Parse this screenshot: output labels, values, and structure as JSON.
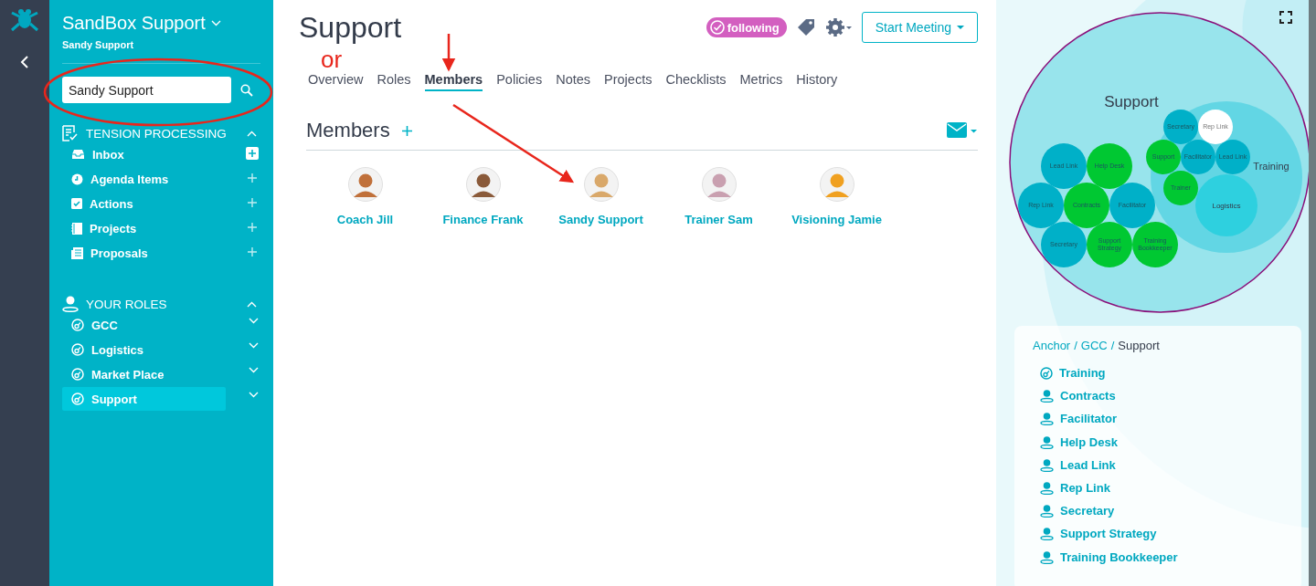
{
  "org": {
    "name": "SandBox Support",
    "user": "Sandy Support"
  },
  "search": {
    "value": "Sandy Support"
  },
  "sections": [
    {
      "title": "TENSION PROCESSING",
      "kind": "tension",
      "expanded": true,
      "items": [
        {
          "label": "Inbox",
          "kind": "inbox",
          "selected": false,
          "highlight": true
        },
        {
          "label": "Agenda Items",
          "kind": "agenda",
          "selected": false,
          "highlight": false
        },
        {
          "label": "Actions",
          "kind": "actions",
          "selected": false,
          "highlight": false
        },
        {
          "label": "Projects",
          "kind": "projects",
          "selected": false,
          "highlight": false
        },
        {
          "label": "Proposals",
          "kind": "proposals",
          "selected": false,
          "highlight": false
        }
      ]
    },
    {
      "title": "YOUR ROLES",
      "kind": "roles",
      "expanded": true,
      "items": [
        {
          "label": "GCC",
          "kind": "circle",
          "selected": false
        },
        {
          "label": "Logistics",
          "kind": "circle",
          "selected": false
        },
        {
          "label": "Market Place",
          "kind": "circle",
          "selected": false
        },
        {
          "label": "Support",
          "kind": "circle",
          "selected": true
        }
      ]
    }
  ],
  "page": {
    "title": "Support",
    "following": "following",
    "start_meeting": "Start Meeting"
  },
  "tabs": [
    {
      "label": "Overview",
      "selected": false
    },
    {
      "label": "Roles",
      "selected": false
    },
    {
      "label": "Members",
      "selected": true
    },
    {
      "label": "Policies",
      "selected": false
    },
    {
      "label": "Notes",
      "selected": false
    },
    {
      "label": "Projects",
      "selected": false
    },
    {
      "label": "Checklists",
      "selected": false
    },
    {
      "label": "Metrics",
      "selected": false
    },
    {
      "label": "History",
      "selected": false
    }
  ],
  "members_heading": "Members",
  "members": [
    {
      "name": "Coach Jill",
      "color": "#c0703a"
    },
    {
      "name": "Finance Frank",
      "color": "#8a5a3a"
    },
    {
      "name": "Sandy Support",
      "color": "#d9a86a"
    },
    {
      "name": "Trainer Sam",
      "color": "#c9a0b0"
    },
    {
      "name": "Visioning Jamie",
      "color": "#f0a020"
    }
  ],
  "annotation": {
    "note": "or"
  },
  "circle_map": {
    "title": "Support",
    "subcircle": "Training",
    "subcircle_main": "Logistics",
    "bubbles": [
      {
        "label": "Lead Link",
        "color": "#00b0c8"
      },
      {
        "label": "Help Desk",
        "color": "#00c832"
      },
      {
        "label": "Rep Link",
        "color": "#00b0c8"
      },
      {
        "label": "Contracts",
        "color": "#00c832"
      },
      {
        "label": "Facilitator",
        "color": "#00b0c8"
      },
      {
        "label": "Secretary",
        "color": "#00b0c8"
      },
      {
        "label": "Support Strategy",
        "color": "#00c832"
      },
      {
        "label": "Training Bookkeeper",
        "color": "#00c832"
      },
      {
        "label": "Secretary",
        "color": "#00b0c8"
      },
      {
        "label": "Rep Link",
        "color": "#ffffff"
      },
      {
        "label": "Support",
        "color": "#00c832"
      },
      {
        "label": "Facilitator",
        "color": "#00b0c8"
      },
      {
        "label": "Lead Link",
        "color": "#00b0c8"
      },
      {
        "label": "Trainer",
        "color": "#00c832"
      }
    ]
  },
  "breadcrumb": {
    "separator": "/",
    "items": [
      "Anchor",
      "GCC",
      "Support"
    ]
  },
  "roles": [
    {
      "label": "Training",
      "kind": "circle"
    },
    {
      "label": "Contracts",
      "kind": "role"
    },
    {
      "label": "Facilitator",
      "kind": "role"
    },
    {
      "label": "Help Desk",
      "kind": "role"
    },
    {
      "label": "Lead Link",
      "kind": "role"
    },
    {
      "label": "Rep Link",
      "kind": "role"
    },
    {
      "label": "Secretary",
      "kind": "role"
    },
    {
      "label": "Support Strategy",
      "kind": "role"
    },
    {
      "label": "Training Bookkeeper",
      "kind": "role"
    }
  ]
}
